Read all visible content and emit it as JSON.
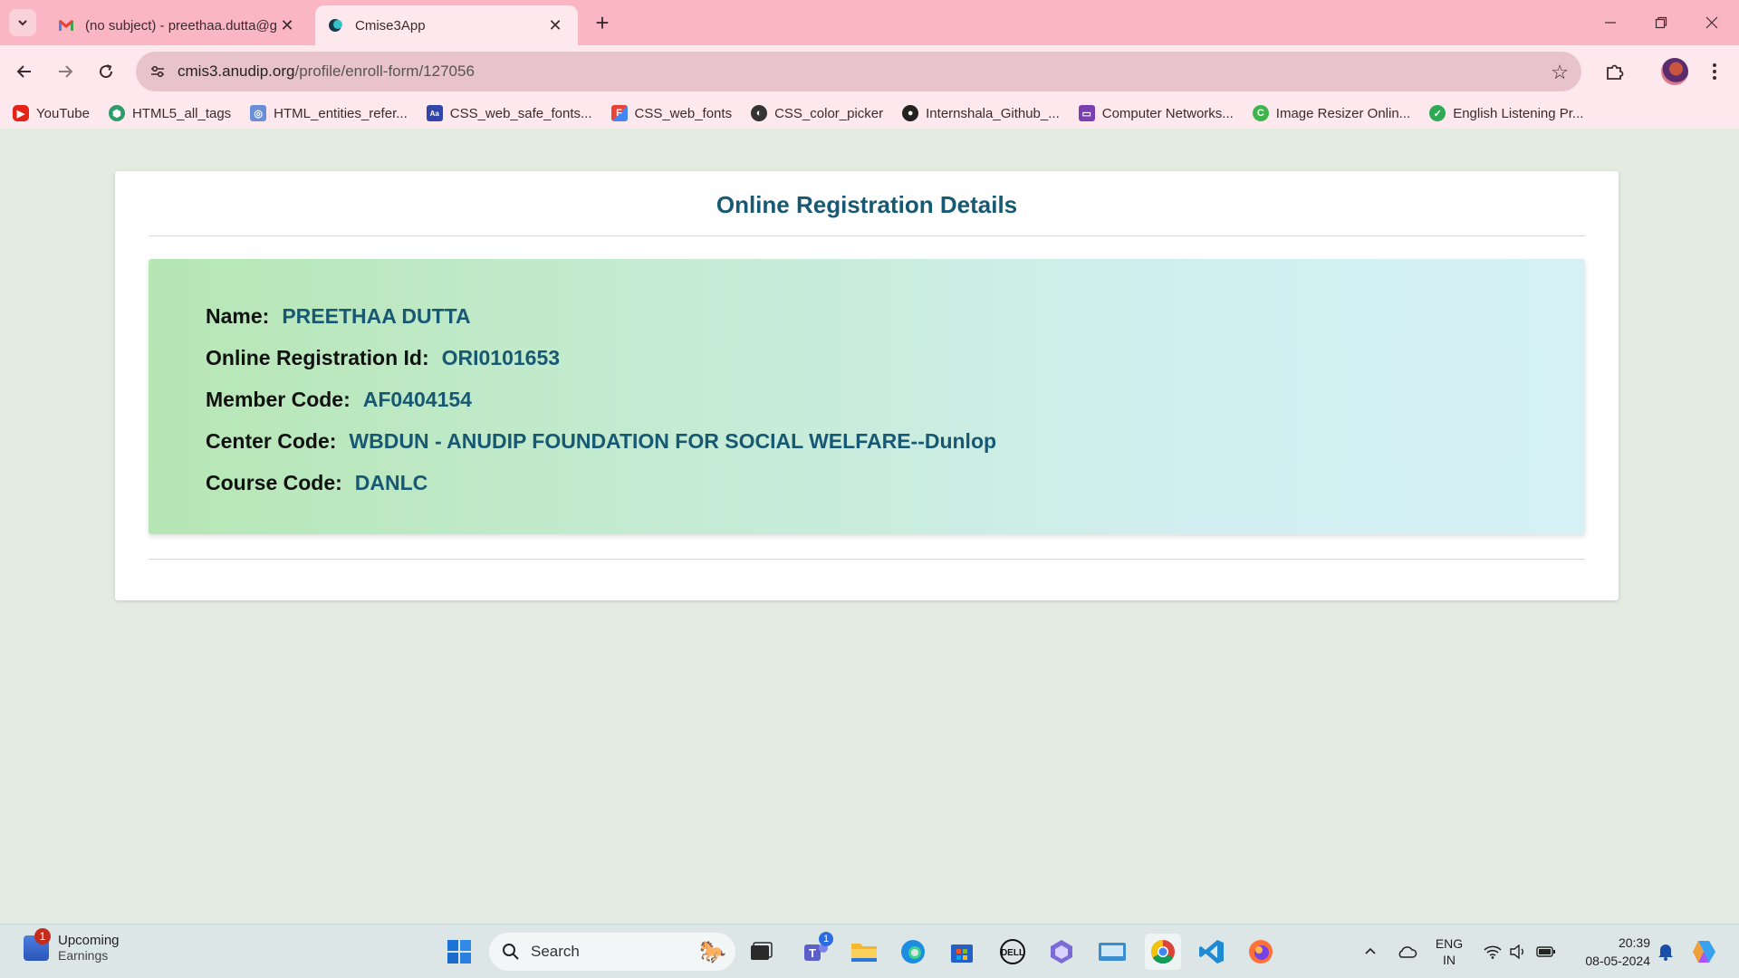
{
  "browser": {
    "tabs": [
      {
        "title": "(no subject) - preethaa.dutta@g",
        "favicon": "gmail-icon",
        "active": false
      },
      {
        "title": "Cmise3App",
        "favicon": "app-icon",
        "active": true
      }
    ],
    "url_host": "cmis3.anudip.org",
    "url_path": "/profile/enroll-form/127056",
    "bookmarks": [
      {
        "label": "YouTube",
        "icon": "youtube-icon",
        "color": "#e62117"
      },
      {
        "label": "HTML5_all_tags",
        "icon": "html5-icon",
        "color": "#2e9b6a"
      },
      {
        "label": "HTML_entities_refer...",
        "icon": "page-icon",
        "color": "#6a8fd8"
      },
      {
        "label": "CSS_web_safe_fonts...",
        "icon": "fonts-icon",
        "color": "#3344aa"
      },
      {
        "label": "CSS_web_fonts",
        "icon": "google-fonts-icon",
        "color": "#ea4335"
      },
      {
        "label": "CSS_color_picker",
        "icon": "color-picker-icon",
        "color": "#333333"
      },
      {
        "label": "Internshala_Github_...",
        "icon": "github-icon",
        "color": "#222222"
      },
      {
        "label": "Computer Networks...",
        "icon": "slides-icon",
        "color": "#7a3fb0"
      },
      {
        "label": "Image Resizer Onlin...",
        "icon": "resizer-icon",
        "color": "#3fb44a"
      },
      {
        "label": "English Listening Pr...",
        "icon": "check-icon",
        "color": "#2eaa55"
      }
    ]
  },
  "page": {
    "title": "Online Registration Details",
    "fields": [
      {
        "label": "Name:",
        "value": "PREETHAA DUTTA"
      },
      {
        "label": "Online Registration Id:",
        "value": "ORI0101653"
      },
      {
        "label": "Member Code:",
        "value": "AF0404154"
      },
      {
        "label": "Center Code:",
        "value": "WBDUN - ANUDIP FOUNDATION FOR SOCIAL WELFARE--Dunlop"
      },
      {
        "label": "Course Code:",
        "value": "DANLC"
      }
    ]
  },
  "taskbar": {
    "widget_title": "Upcoming",
    "widget_subtitle": "Earnings",
    "widget_badge": "1",
    "search_placeholder": "Search",
    "teams_badge": "1",
    "lang_line1": "ENG",
    "lang_line2": "IN",
    "time": "20:39",
    "date": "08-05-2024"
  },
  "colors": {
    "tabstrip": "#fbb6c4",
    "toolbar": "#fde9ed",
    "page_bg": "#e4ebe0",
    "heading": "#175873",
    "info_gradient_start": "#b6e6b4",
    "info_gradient_end": "#d5f1f6"
  }
}
